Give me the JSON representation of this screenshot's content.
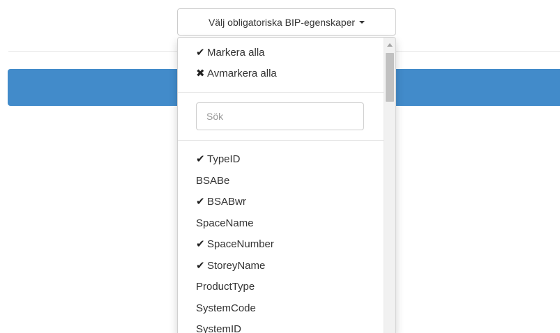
{
  "toggle": {
    "label": "Välj obligatoriska BIP-egenskaper"
  },
  "actions": {
    "select_all": "Markera alla",
    "deselect_all": "Avmarkera alla"
  },
  "search": {
    "placeholder": "Sök"
  },
  "properties": [
    {
      "label": "TypeID",
      "checked": true
    },
    {
      "label": "BSABe",
      "checked": false
    },
    {
      "label": "BSABwr",
      "checked": true
    },
    {
      "label": "SpaceName",
      "checked": false
    },
    {
      "label": "SpaceNumber",
      "checked": true
    },
    {
      "label": "StoreyName",
      "checked": true
    },
    {
      "label": "ProductType",
      "checked": false
    },
    {
      "label": "SystemCode",
      "checked": false
    },
    {
      "label": "SystemID",
      "checked": false
    }
  ],
  "icons": {
    "check": "✔",
    "cross": "✖",
    "caret": "caret-down-icon"
  },
  "colors": {
    "primary_bar": "#428bca",
    "border": "#cccccc",
    "scroll_thumb": "#c1c1c1"
  }
}
